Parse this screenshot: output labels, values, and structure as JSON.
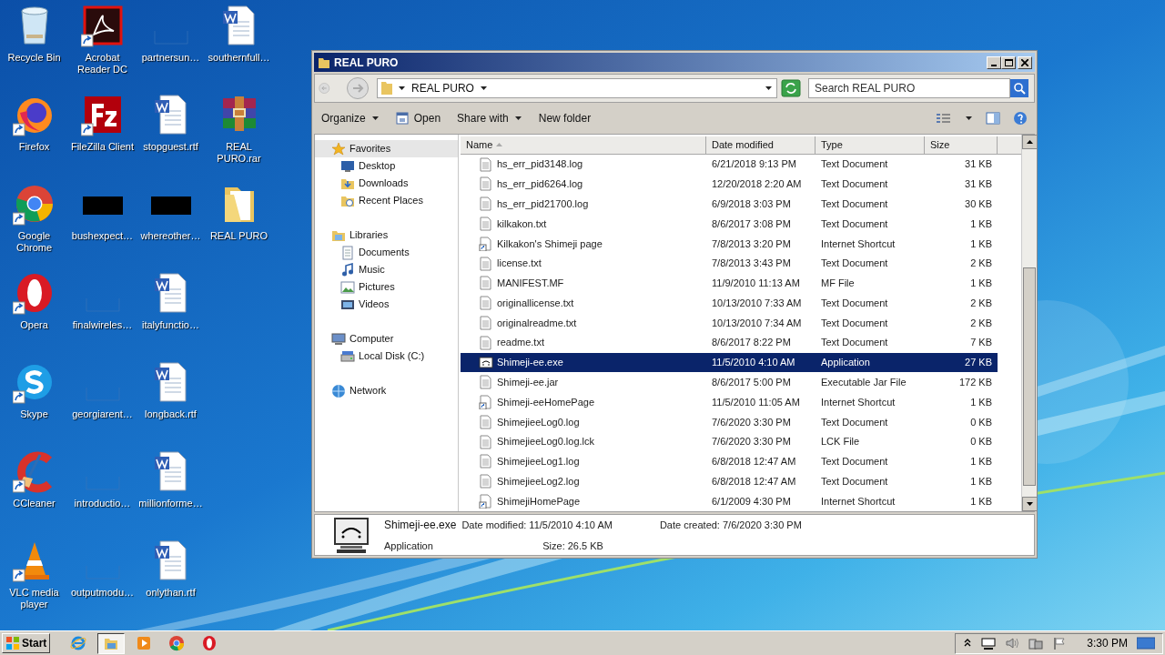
{
  "desktop": {
    "icons": [
      {
        "label": "Recycle Bin",
        "kind": "recycle",
        "shortcut": false
      },
      {
        "label": "Firefox",
        "kind": "firefox",
        "shortcut": true
      },
      {
        "label": "Google Chrome",
        "kind": "chrome",
        "shortcut": true
      },
      {
        "label": "Opera",
        "kind": "opera",
        "shortcut": true
      },
      {
        "label": "Skype",
        "kind": "skype",
        "shortcut": true
      },
      {
        "label": "CCleaner",
        "kind": "ccleaner",
        "shortcut": true
      },
      {
        "label": "VLC media player",
        "kind": "vlc",
        "shortcut": true
      },
      {
        "label": "Acrobat Reader DC",
        "kind": "acrobat",
        "shortcut": true
      },
      {
        "label": "FileZilla Client",
        "kind": "filezilla",
        "shortcut": true
      },
      {
        "label": "bushexpect…",
        "kind": "dark",
        "shortcut": false
      },
      {
        "label": "finalwireles…",
        "kind": "blank",
        "shortcut": false
      },
      {
        "label": "georgiarent…",
        "kind": "blank",
        "shortcut": false
      },
      {
        "label": "introductio…",
        "kind": "blank",
        "shortcut": false
      },
      {
        "label": "outputmodu…",
        "kind": "blank",
        "shortcut": false
      },
      {
        "label": "partnersun…",
        "kind": "blank",
        "shortcut": false
      },
      {
        "label": "stopguest.rtf",
        "kind": "word",
        "shortcut": false
      },
      {
        "label": "whereother…",
        "kind": "dark",
        "shortcut": false
      },
      {
        "label": "italyfunctio…",
        "kind": "word",
        "shortcut": false
      },
      {
        "label": "longback.rtf",
        "kind": "word",
        "shortcut": false
      },
      {
        "label": "millionforme…",
        "kind": "word",
        "shortcut": false
      },
      {
        "label": "onlythan.rtf",
        "kind": "word",
        "shortcut": false
      },
      {
        "label": "southernfull…",
        "kind": "word",
        "shortcut": false
      },
      {
        "label": "REAL PURO.rar",
        "kind": "rar",
        "shortcut": false
      },
      {
        "label": "REAL PURO",
        "kind": "folder",
        "shortcut": false
      }
    ]
  },
  "window": {
    "title": "REAL PURO",
    "address": {
      "path": "REAL PURO",
      "search_placeholder": "Search REAL PURO"
    },
    "toolbar": [
      {
        "label": "Organize",
        "kind": "menu"
      },
      {
        "label": "Open",
        "kind": "open"
      },
      {
        "label": "Share with",
        "kind": "menu"
      },
      {
        "label": "New folder",
        "kind": "plain"
      }
    ],
    "sidebar": {
      "items": [
        {
          "label": "Favorites",
          "kind": "star",
          "selected": true,
          "children": [
            {
              "label": "Desktop",
              "kind": "desktop",
              "selected": false
            },
            {
              "label": "Downloads",
              "kind": "downloads",
              "selected": false
            },
            {
              "label": "Recent Places",
              "kind": "recent",
              "selected": false
            }
          ]
        },
        {
          "label": "Libraries",
          "kind": "library",
          "selected": false,
          "children": [
            {
              "label": "Documents",
              "kind": "documents",
              "selected": false
            },
            {
              "label": "Music",
              "kind": "music",
              "selected": false
            },
            {
              "label": "Pictures",
              "kind": "pictures",
              "selected": false
            },
            {
              "label": "Videos",
              "kind": "videos",
              "selected": false
            }
          ]
        },
        {
          "label": "Computer",
          "kind": "computer",
          "selected": false,
          "children": [
            {
              "label": "Local Disk (C:)",
              "kind": "disk",
              "selected": false
            }
          ]
        },
        {
          "label": "Network",
          "kind": "network",
          "selected": false
        }
      ]
    },
    "table": {
      "columns": [
        {
          "label": "Name",
          "sorted": true
        },
        {
          "label": "Date modified",
          "sorted": false
        },
        {
          "label": "Type",
          "sorted": false
        },
        {
          "label": "Size",
          "sorted": false
        }
      ],
      "rows": [
        {
          "kind": "text",
          "name": "hs_err_pid3148.log",
          "date": "6/21/2018 9:13 PM",
          "type": "Text Document",
          "size": "31 KB",
          "selected": false
        },
        {
          "kind": "text",
          "name": "hs_err_pid6264.log",
          "date": "12/20/2018 2:20 AM",
          "type": "Text Document",
          "size": "31 KB",
          "selected": false
        },
        {
          "kind": "text",
          "name": "hs_err_pid21700.log",
          "date": "6/9/2018 3:03 PM",
          "type": "Text Document",
          "size": "30 KB",
          "selected": false
        },
        {
          "kind": "text",
          "name": "kilkakon.txt",
          "date": "8/6/2017 3:08 PM",
          "type": "Text Document",
          "size": "1 KB",
          "selected": false
        },
        {
          "kind": "link",
          "name": "Kilkakon's Shimeji page",
          "date": "7/8/2013 3:20 PM",
          "type": "Internet Shortcut",
          "size": "1 KB",
          "selected": false
        },
        {
          "kind": "text",
          "name": "license.txt",
          "date": "7/8/2013 3:43 PM",
          "type": "Text Document",
          "size": "2 KB",
          "selected": false
        },
        {
          "kind": "text",
          "name": "MANIFEST.MF",
          "date": "11/9/2010 11:13 AM",
          "type": "MF File",
          "size": "1 KB",
          "selected": false
        },
        {
          "kind": "text",
          "name": "originallicense.txt",
          "date": "10/13/2010 7:33 AM",
          "type": "Text Document",
          "size": "2 KB",
          "selected": false
        },
        {
          "kind": "text",
          "name": "originalreadme.txt",
          "date": "10/13/2010 7:34 AM",
          "type": "Text Document",
          "size": "2 KB",
          "selected": false
        },
        {
          "kind": "text",
          "name": "readme.txt",
          "date": "8/6/2017 8:22 PM",
          "type": "Text Document",
          "size": "7 KB",
          "selected": false
        },
        {
          "kind": "app",
          "name": "Shimeji-ee.exe",
          "date": "11/5/2010 4:10 AM",
          "type": "Application",
          "size": "27 KB",
          "selected": true
        },
        {
          "kind": "text",
          "name": "Shimeji-ee.jar",
          "date": "8/6/2017 5:00 PM",
          "type": "Executable Jar File",
          "size": "172 KB",
          "selected": false
        },
        {
          "kind": "link",
          "name": "Shimeji-eeHomePage",
          "date": "11/5/2010 11:05 AM",
          "type": "Internet Shortcut",
          "size": "1 KB",
          "selected": false
        },
        {
          "kind": "text",
          "name": "ShimejieeLog0.log",
          "date": "7/6/2020 3:30 PM",
          "type": "Text Document",
          "size": "0 KB",
          "selected": false
        },
        {
          "kind": "text",
          "name": "ShimejieeLog0.log.lck",
          "date": "7/6/2020 3:30 PM",
          "type": "LCK File",
          "size": "0 KB",
          "selected": false
        },
        {
          "kind": "text",
          "name": "ShimejieeLog1.log",
          "date": "6/8/2018 12:47 AM",
          "type": "Text Document",
          "size": "1 KB",
          "selected": false
        },
        {
          "kind": "text",
          "name": "ShimejieeLog2.log",
          "date": "6/8/2018 12:47 AM",
          "type": "Text Document",
          "size": "1 KB",
          "selected": false
        },
        {
          "kind": "link",
          "name": "ShimejiHomePage",
          "date": "6/1/2009 4:30 PM",
          "type": "Internet Shortcut",
          "size": "1 KB",
          "selected": false
        }
      ]
    },
    "details": {
      "name": "Shimeji-ee.exe",
      "type": "Application",
      "modified_label": "Date modified:",
      "modified": "11/5/2010 4:10 AM",
      "created_label": "Date created:",
      "created": "7/6/2020 3:30 PM",
      "size_label": "Size:",
      "size": "26.5 KB"
    }
  },
  "taskbar": {
    "start": "Start",
    "apps": [
      {
        "kind": "ie",
        "selected": false
      },
      {
        "kind": "explorer",
        "selected": true
      },
      {
        "kind": "media",
        "selected": false
      },
      {
        "kind": "chrome",
        "selected": false
      },
      {
        "kind": "opera",
        "selected": false
      }
    ],
    "tray": [
      {
        "kind": "chevron"
      },
      {
        "kind": "display"
      },
      {
        "kind": "volume"
      },
      {
        "kind": "network"
      },
      {
        "kind": "flag"
      }
    ],
    "clock": "3:30 PM"
  }
}
